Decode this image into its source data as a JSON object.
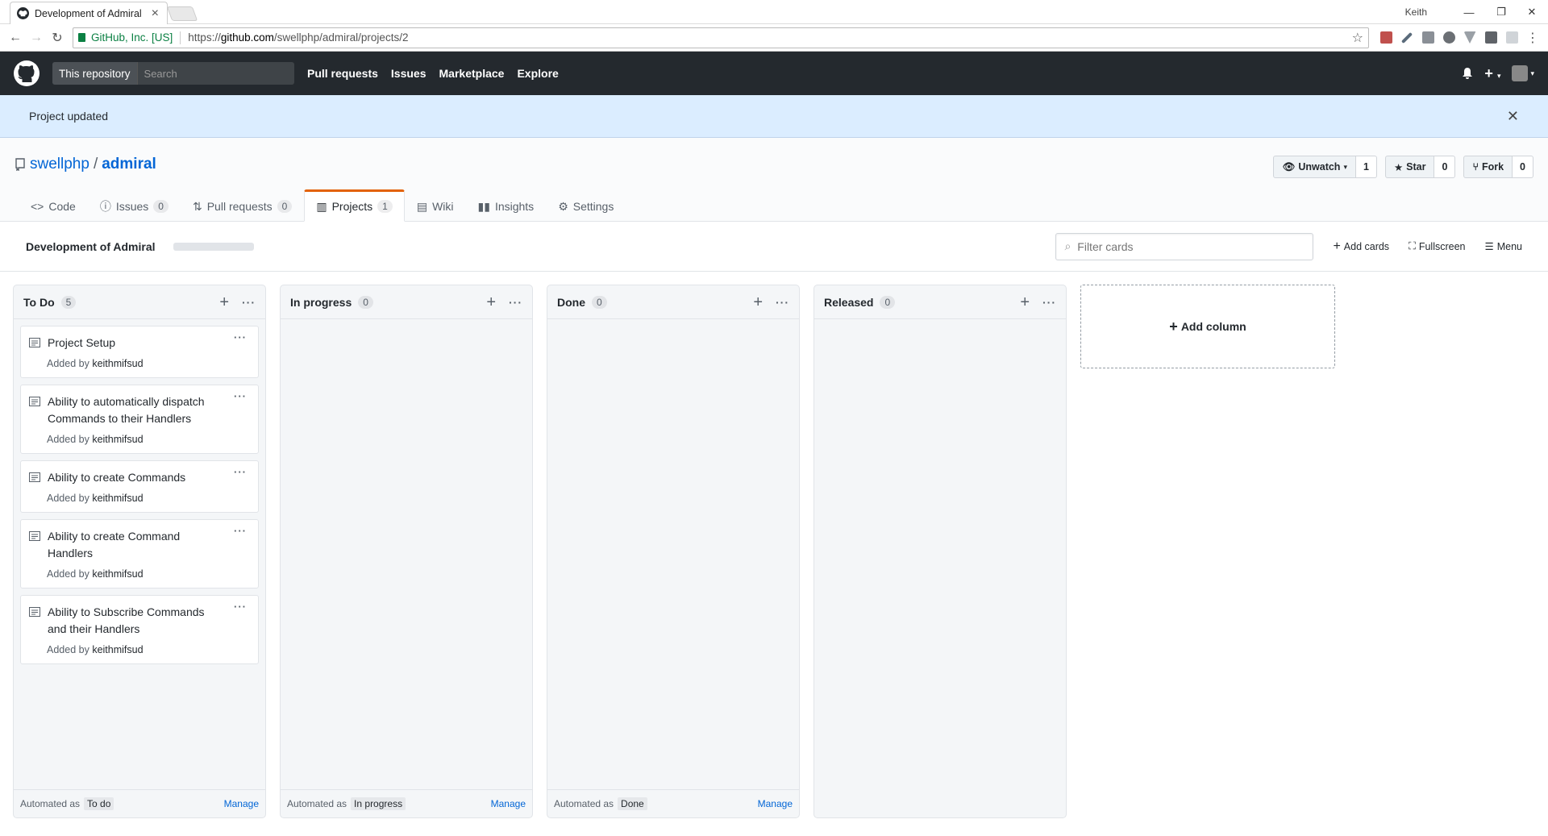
{
  "browser": {
    "tab_title": "Development of Admiral",
    "profile_name": "Keith",
    "secure_label": "GitHub, Inc. [US]",
    "url_scheme": "https://",
    "url_host": "github.com",
    "url_path": "/swellphp/admiral/projects/2"
  },
  "header": {
    "search_scope": "This repository",
    "search_placeholder": "Search",
    "nav": [
      "Pull requests",
      "Issues",
      "Marketplace",
      "Explore"
    ]
  },
  "flash": {
    "message": "Project updated"
  },
  "repo": {
    "owner": "swellphp",
    "name": "admiral",
    "watch_label": "Unwatch",
    "watch_count": "1",
    "star_label": "Star",
    "star_count": "0",
    "fork_label": "Fork",
    "fork_count": "0",
    "tabs": [
      {
        "label": "Code",
        "icon": "code-icon"
      },
      {
        "label": "Issues",
        "count": "0",
        "icon": "issue-icon"
      },
      {
        "label": "Pull requests",
        "count": "0",
        "icon": "pull-request-icon"
      },
      {
        "label": "Projects",
        "count": "1",
        "icon": "project-icon",
        "selected": true
      },
      {
        "label": "Wiki",
        "icon": "book-icon"
      },
      {
        "label": "Insights",
        "icon": "graph-icon"
      },
      {
        "label": "Settings",
        "icon": "gear-icon"
      }
    ]
  },
  "project": {
    "name": "Development of Admiral",
    "filter_placeholder": "Filter cards",
    "add_cards_label": "Add cards",
    "fullscreen_label": "Fullscreen",
    "menu_label": "Menu"
  },
  "columns": [
    {
      "name": "To Do",
      "count": "5",
      "automated_label": "Automated as",
      "automated_tag": "To do",
      "manage_label": "Manage",
      "cards": [
        {
          "title": "Project Setup",
          "added_by_label": "Added by",
          "author": "keithmifsud"
        },
        {
          "title": "Ability to automatically dispatch Commands to their Handlers",
          "added_by_label": "Added by",
          "author": "keithmifsud"
        },
        {
          "title": "Ability to create Commands",
          "added_by_label": "Added by",
          "author": "keithmifsud"
        },
        {
          "title": "Ability to create Command Handlers",
          "added_by_label": "Added by",
          "author": "keithmifsud"
        },
        {
          "title": "Ability to Subscribe Commands and their Handlers",
          "added_by_label": "Added by",
          "author": "keithmifsud"
        }
      ]
    },
    {
      "name": "In progress",
      "count": "0",
      "automated_label": "Automated as",
      "automated_tag": "In progress",
      "manage_label": "Manage",
      "cards": []
    },
    {
      "name": "Done",
      "count": "0",
      "automated_label": "Automated as",
      "automated_tag": "Done",
      "manage_label": "Manage",
      "cards": []
    },
    {
      "name": "Released",
      "count": "0",
      "cards": []
    }
  ],
  "add_column_label": "Add column",
  "colors": {
    "header_bg": "#24292e",
    "flash_bg": "#dbedff",
    "link": "#0366d6",
    "selected_tab_accent": "#e36209"
  }
}
